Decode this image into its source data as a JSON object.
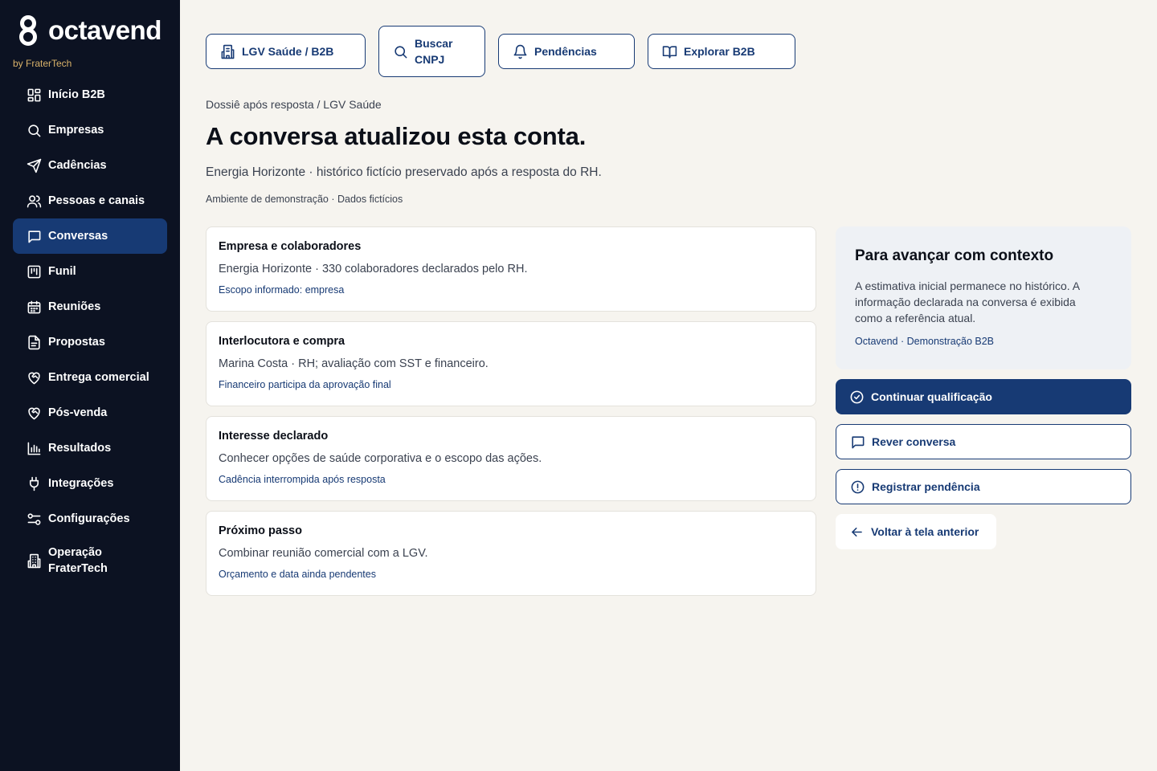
{
  "brand": {
    "name": "octavend",
    "by": "by FraterTech",
    "mark_icon": "octavend-8-logo"
  },
  "sidebar": {
    "items": [
      {
        "label": "Início B2B",
        "icon": "grid-icon"
      },
      {
        "label": "Empresas",
        "icon": "search-icon"
      },
      {
        "label": "Cadências",
        "icon": "send-icon"
      },
      {
        "label": "Pessoas e canais",
        "icon": "users-icon"
      },
      {
        "label": "Conversas",
        "icon": "message-icon",
        "active": true
      },
      {
        "label": "Funil",
        "icon": "kanban-icon"
      },
      {
        "label": "Reuniões",
        "icon": "calendar-icon"
      },
      {
        "label": "Propostas",
        "icon": "document-icon"
      },
      {
        "label": "Entrega comercial",
        "icon": "heart-handshake-icon"
      },
      {
        "label": "Pós-venda",
        "icon": "heart-handshake-icon"
      },
      {
        "label": "Resultados",
        "icon": "bar-chart-icon"
      },
      {
        "label": "Integrações",
        "icon": "plug-icon"
      },
      {
        "label": "Configurações",
        "icon": "sliders-icon"
      },
      {
        "label": "Operação FraterTech",
        "icon": "building-icon"
      }
    ]
  },
  "topbar": {
    "account": {
      "label": "LGV Saúde / B2B",
      "icon": "building-icon"
    },
    "search_cnpj": {
      "label": "Buscar CNPJ",
      "icon": "search-icon"
    },
    "pending": {
      "label": "Pendências",
      "icon": "bell-icon"
    },
    "explore": {
      "label": "Explorar B2B",
      "icon": "book-open-icon"
    }
  },
  "header": {
    "breadcrumb": "Dossiê após resposta / LGV Saúde",
    "title": "A conversa atualizou esta conta.",
    "subtitle": "Energia Horizonte · histórico fictício preservado após a resposta do RH.",
    "note": "Ambiente de demonstração · Dados fictícios"
  },
  "cards": [
    {
      "title": "Empresa e colaboradores",
      "body": "Energia Horizonte · 330 colaboradores declarados pelo RH.",
      "note": "Escopo informado: empresa"
    },
    {
      "title": "Interlocutora e compra",
      "body": "Marina Costa · RH; avaliação com SST e financeiro.",
      "note": "Financeiro participa da aprovação final"
    },
    {
      "title": "Interesse declarado",
      "body": "Conhecer opções de saúde corporativa e o escopo das ações.",
      "note": "Cadência interrompida após resposta"
    },
    {
      "title": "Próximo passo",
      "body": "Combinar reunião comercial com a LGV.",
      "note": "Orçamento e data ainda pendentes"
    }
  ],
  "context": {
    "title": "Para avançar com contexto",
    "text": "A estimativa inicial permanece no histórico. A informação declarada na conversa é exibida como a referência atual.",
    "foot": "Octavend · Demonstração B2B"
  },
  "actions": {
    "continue": {
      "label": "Continuar qualificação",
      "icon": "check-circle-icon"
    },
    "review": {
      "label": "Rever conversa",
      "icon": "message-icon"
    },
    "register": {
      "label": "Registrar pendência",
      "icon": "alert-circle-icon"
    },
    "back": {
      "label": "Voltar à tela anterior",
      "icon": "arrow-left-icon"
    }
  },
  "colors": {
    "sidebar_bg": "#0c1222",
    "accent": "#173a74",
    "page_bg": "#f6f4ef",
    "context_bg": "#eef1f5",
    "brand_by": "#d9b26a"
  }
}
